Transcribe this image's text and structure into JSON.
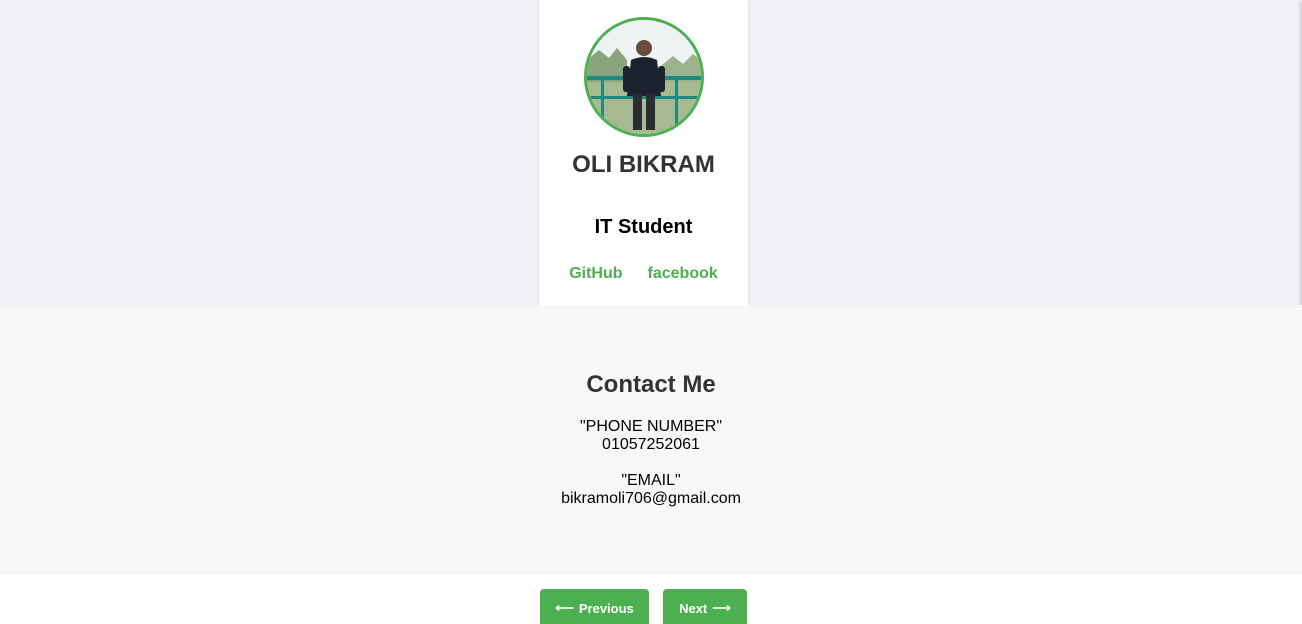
{
  "profile": {
    "name": "OLI BIKRAM",
    "role": "IT Student",
    "links": [
      {
        "label": "GitHub"
      },
      {
        "label": "facebook"
      }
    ],
    "avatar_icon": "profile-photo"
  },
  "contact": {
    "heading": "Contact Me",
    "phone_label": "\"PHONE NUMBER\"",
    "phone_value": "01057252061",
    "email_label": "\"EMAIL\"",
    "email_value": "bikramoli706@gmail.com"
  },
  "nav": {
    "prev_label": "Previous",
    "next_label": "Next",
    "prev_icon": "arrow-left-icon",
    "next_icon": "arrow-right-icon"
  },
  "colors": {
    "accent": "#4caf50",
    "hero_bg": "#f0f1f5",
    "contact_bg": "#f7f7f7",
    "heading_text": "#333333"
  }
}
